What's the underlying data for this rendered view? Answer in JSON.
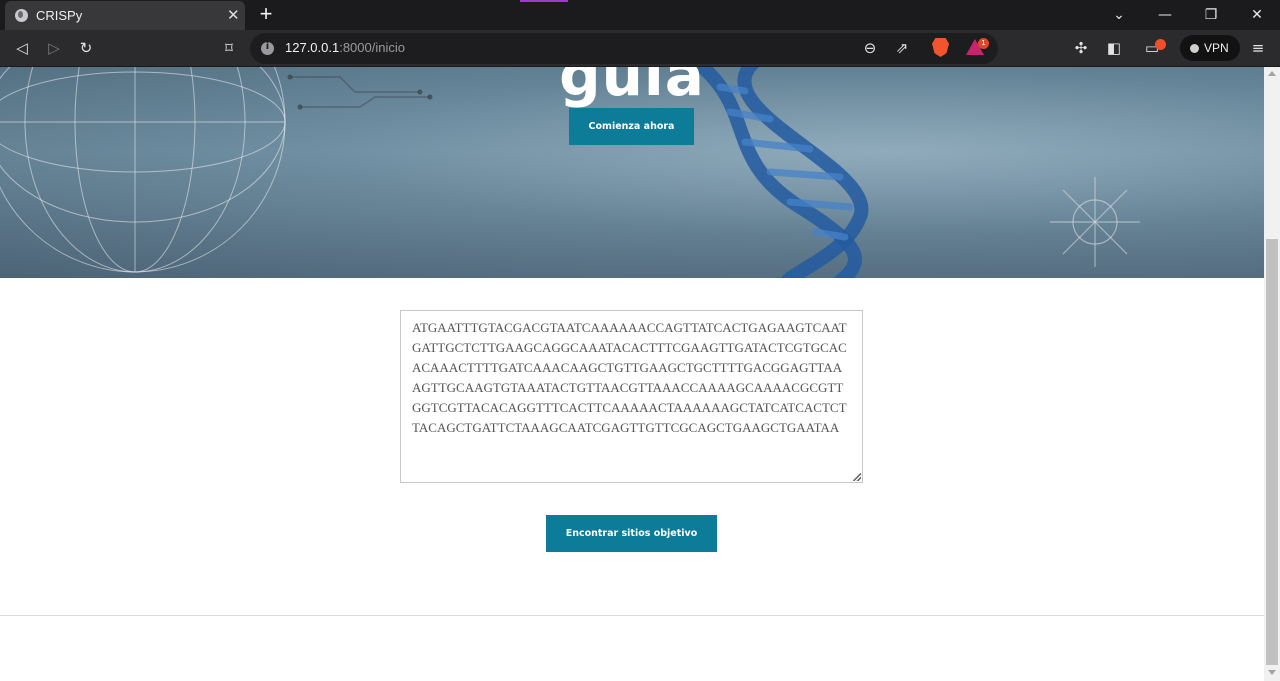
{
  "browser": {
    "tab_title": "CRISPy",
    "tab_close": "✕",
    "new_tab": "+",
    "url_host": "127.0.0.1",
    "url_rest": ":8000/inicio",
    "rewards_badge": "1",
    "vpn_label": "VPN"
  },
  "hero": {
    "title": "guía",
    "cta_label": "Comienza ahora"
  },
  "form": {
    "sequence": "ATGAATTTGTACGACGTAATCAAAAAACCAGTTATCACTGAGAAGTCAATGATTGCTCTTGAAGCAGGCAAATACACTTTCGAAGTTGATACTCGTGCACACAAACTTTTGATCAAACAAGCTGTTGAAGCTGCTTTTGACGGAGTTAAAGTTGCAAGTGTAAATACTGTTAACGTTAAACCAAAAGCAAAACGCGTTGGTCGTTACACAGGTTTCACTTCAAAAACTAAAAAAGCTATCATCACTCTTACAGCTGATTCTAAAGCAATCGAGTTGTTCGCAGCTGAAGCTGAATAA",
    "submit_label": "Encontrar sitios objetivo"
  }
}
